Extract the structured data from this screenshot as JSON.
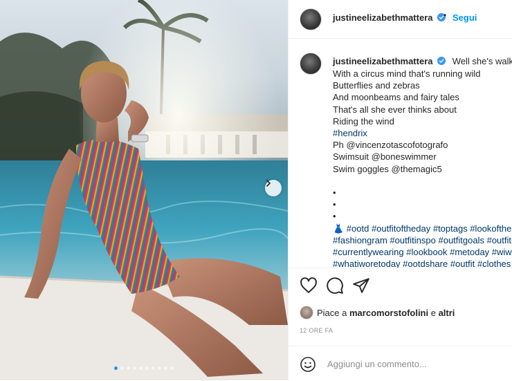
{
  "post": {
    "username": "justineelizabethmattera",
    "follow_label": "Segui",
    "separator": "•",
    "carousel_total": 10,
    "carousel_active": 1
  },
  "caption": {
    "first_line": "Well she's walkin",
    "lines": [
      {
        "text": "With a circus mind that's running wild",
        "link": false
      },
      {
        "text": "Butterflies and zebras",
        "link": false
      },
      {
        "text": "And moonbeams and fairy tales",
        "link": false
      },
      {
        "text": "That's all she ever thinks about",
        "link": false
      },
      {
        "text": "Riding the wind",
        "link": false
      },
      {
        "text": "#hendrix",
        "link": true
      },
      {
        "text": "Ph @vincenzotascofotografo",
        "link": false
      },
      {
        "text": "Swimsuit @boneswimmer",
        "link": false
      },
      {
        "text": "Swim goggles @themagic5",
        "link": false
      },
      {
        "text": "",
        "link": false
      },
      {
        "text": "•",
        "link": false
      },
      {
        "text": "•",
        "link": false
      },
      {
        "text": "•",
        "link": false
      },
      {
        "text": "👗 #ootd #outfitoftheday #toptags #lookoftheday",
        "link": true
      },
      {
        "text": "#fashiongram #outfitinspo #outfitgoals #outfit",
        "link": true
      },
      {
        "text": "#currentlywearing #lookbook #metoday #wiwt",
        "link": true
      },
      {
        "text": "#whatiworetoday #ootdshare #outfit #clothes",
        "link": true
      }
    ]
  },
  "likes": {
    "prefix": "Piace a ",
    "user": "marcomorstofolini",
    "suffix": " e ",
    "others": "altri"
  },
  "timestamp": "12 ORE FA",
  "comment": {
    "placeholder": "Aggiungi un commento..."
  },
  "icons": {
    "like": "heart-icon",
    "comment": "comment-bubble-icon",
    "share": "paper-plane-icon",
    "emoji": "smiley-icon",
    "next": "chevron-right-icon",
    "verified": "verified-badge-icon"
  },
  "colors": {
    "accent": "#0095f6",
    "link": "#00376b",
    "verified": "#3897f0",
    "muted": "#8e8e8e"
  }
}
